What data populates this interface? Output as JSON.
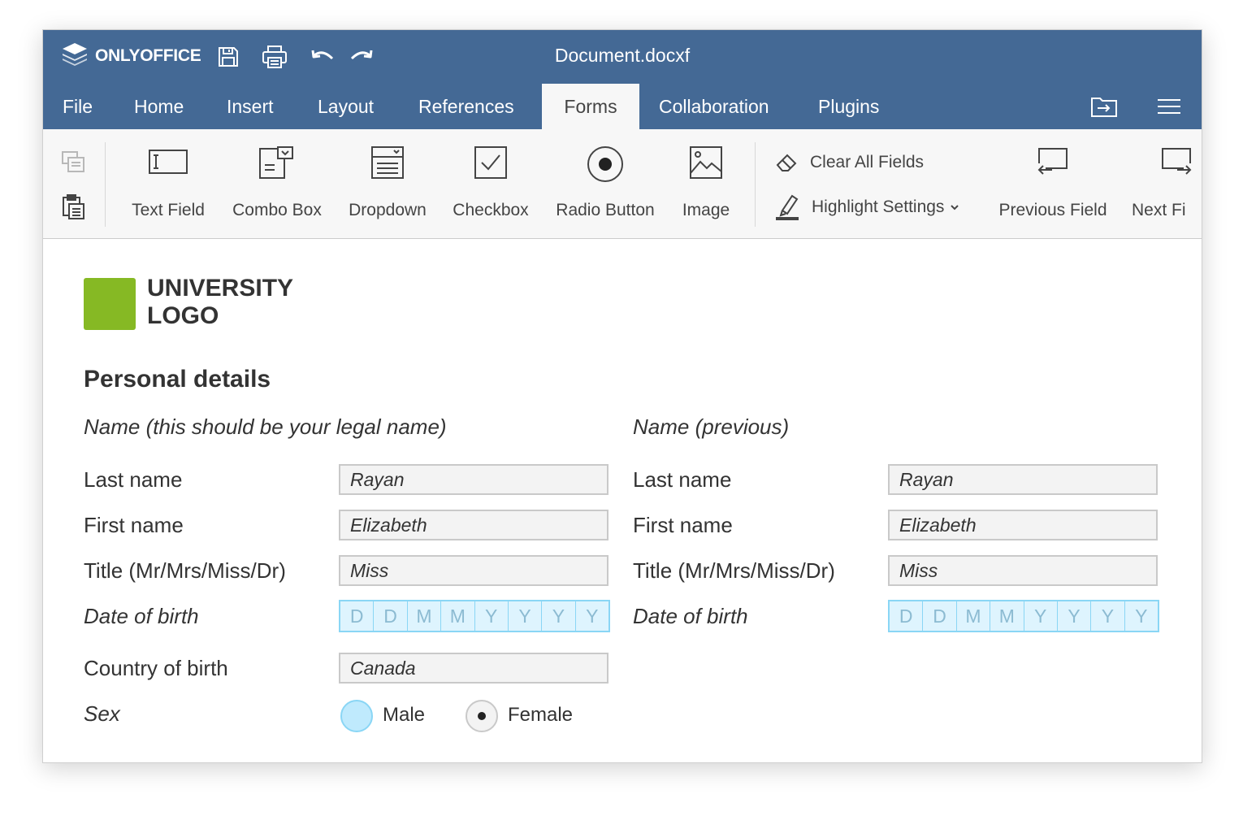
{
  "app": {
    "brand": "ONLYOFFICE",
    "document_title": "Document.docxf"
  },
  "tabs": [
    {
      "label": "File"
    },
    {
      "label": "Home"
    },
    {
      "label": "Insert"
    },
    {
      "label": "Layout"
    },
    {
      "label": "References"
    },
    {
      "label": "Forms",
      "active": true
    },
    {
      "label": "Collaboration"
    },
    {
      "label": "Plugins"
    }
  ],
  "toolbar": {
    "text_field": "Text Field",
    "combo_box": "Combo Box",
    "dropdown": "Dropdown",
    "checkbox": "Checkbox",
    "radio_button": "Radio Button",
    "image": "Image",
    "clear_all_fields": "Clear All Fields",
    "highlight_settings": "Highlight Settings",
    "previous_field": "Previous Field",
    "next_field": "Next Fi"
  },
  "document": {
    "logo_line1": "UNIVERSITY",
    "logo_line2": "LOGO",
    "section_title": "Personal details",
    "left": {
      "subheading": "Name (this should be your legal name)",
      "last_name_label": "Last name",
      "last_name_value": "Rayan",
      "first_name_label": "First name",
      "first_name_value": "Elizabeth",
      "title_label": "Title (Mr/Mrs/Miss/Dr)",
      "title_value": "Miss",
      "dob_label": "Date of birth",
      "dob_cells": [
        "D",
        "D",
        "M",
        "M",
        "Y",
        "Y",
        "Y",
        "Y"
      ],
      "country_label": "Country of birth",
      "country_value": "Canada",
      "sex_label": "Sex",
      "sex_male": "Male",
      "sex_female": "Female",
      "sex_selected": "Female"
    },
    "right": {
      "subheading": "Name (previous)",
      "last_name_label": "Last name",
      "last_name_value": "Rayan",
      "first_name_label": "First name",
      "first_name_value": "Elizabeth",
      "title_label": "Title (Mr/Mrs/Miss/Dr)",
      "title_value": "Miss",
      "dob_label": "Date of birth",
      "dob_cells": [
        "D",
        "D",
        "M",
        "M",
        "Y",
        "Y",
        "Y",
        "Y"
      ]
    }
  },
  "colors": {
    "header_blue": "#446995",
    "logo_green": "#86b924",
    "comb_fill": "#def4fe",
    "comb_border": "#8ad6f5"
  }
}
